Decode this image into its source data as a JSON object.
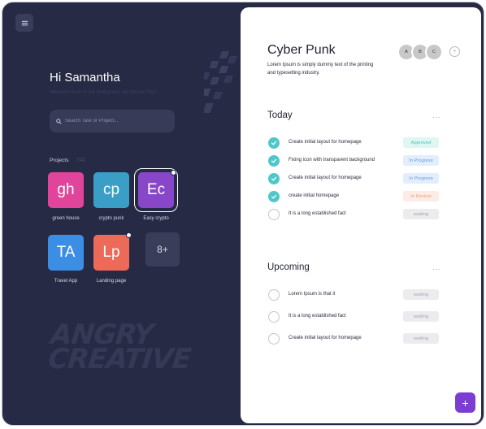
{
  "sidebar": {
    "menu_icon": "menu-icon",
    "greeting": "Hi Samantha",
    "welcome": "Welcome back to the workspace, we missed You!",
    "search": {
      "placeholder": "Search Task or Project..."
    },
    "projects_label": "Projects",
    "projects_count": "(11)",
    "projects": [
      {
        "initials": "gh",
        "name": "green house",
        "color": "#e1459b",
        "has_dot": false,
        "selected": false
      },
      {
        "initials": "cp",
        "name": "crypto punk",
        "color": "#3b9ec7",
        "has_dot": false,
        "selected": false
      },
      {
        "initials": "Ec",
        "name": "Easy crypto",
        "color": "#8847c9",
        "has_dot": true,
        "selected": true
      },
      {
        "initials": "TA",
        "name": "Travel App",
        "color": "#3c8ee4",
        "has_dot": false,
        "selected": false
      },
      {
        "initials": "Lp",
        "name": "Landing page",
        "color": "#ee6a58",
        "has_dot": true,
        "selected": false
      }
    ],
    "more_label": "8+",
    "brand_line1": "ANGRY",
    "brand_line2": "CREATIVE"
  },
  "project": {
    "title": "Cyber Punk",
    "description": "Lorem Ipsum is simply dummy text of the printing and typesetting industry.",
    "members": [
      "A",
      "B",
      "C"
    ],
    "add_member": "+"
  },
  "today": {
    "title": "Today",
    "more": "...",
    "tasks": [
      {
        "text": "Create initial layout for homepage",
        "done": true,
        "status": "Approved",
        "status_bg": "#dff6f3",
        "status_fg": "#52c2b4"
      },
      {
        "text": "Fixing icon with transparent background",
        "done": true,
        "status": "In Progress",
        "status_bg": "#e3eefc",
        "status_fg": "#6d98dc"
      },
      {
        "text": "Create initial layout for homepage",
        "done": true,
        "status": "In Progress",
        "status_bg": "#e3eefc",
        "status_fg": "#6d98dc"
      },
      {
        "text": "create initial homepage",
        "done": true,
        "status": "In Review",
        "status_bg": "#fdece6",
        "status_fg": "#ee9f86"
      },
      {
        "text": "It is a long established fact",
        "done": false,
        "status": "waiting",
        "status_bg": "#ececef",
        "status_fg": "#a4a5b0"
      }
    ]
  },
  "upcoming": {
    "title": "Upcoming",
    "more": "...",
    "tasks": [
      {
        "text": "Lorem Ipsum is that it",
        "done": false,
        "status": "waiting",
        "status_bg": "#ececef",
        "status_fg": "#a4a5b0"
      },
      {
        "text": "It is a long established fact",
        "done": false,
        "status": "waiting",
        "status_bg": "#ececef",
        "status_fg": "#a4a5b0"
      },
      {
        "text": "Create initial layout for homepage",
        "done": false,
        "status": "waiting",
        "status_bg": "#ececef",
        "status_fg": "#a4a5b0"
      }
    ]
  },
  "fab_label": "+"
}
